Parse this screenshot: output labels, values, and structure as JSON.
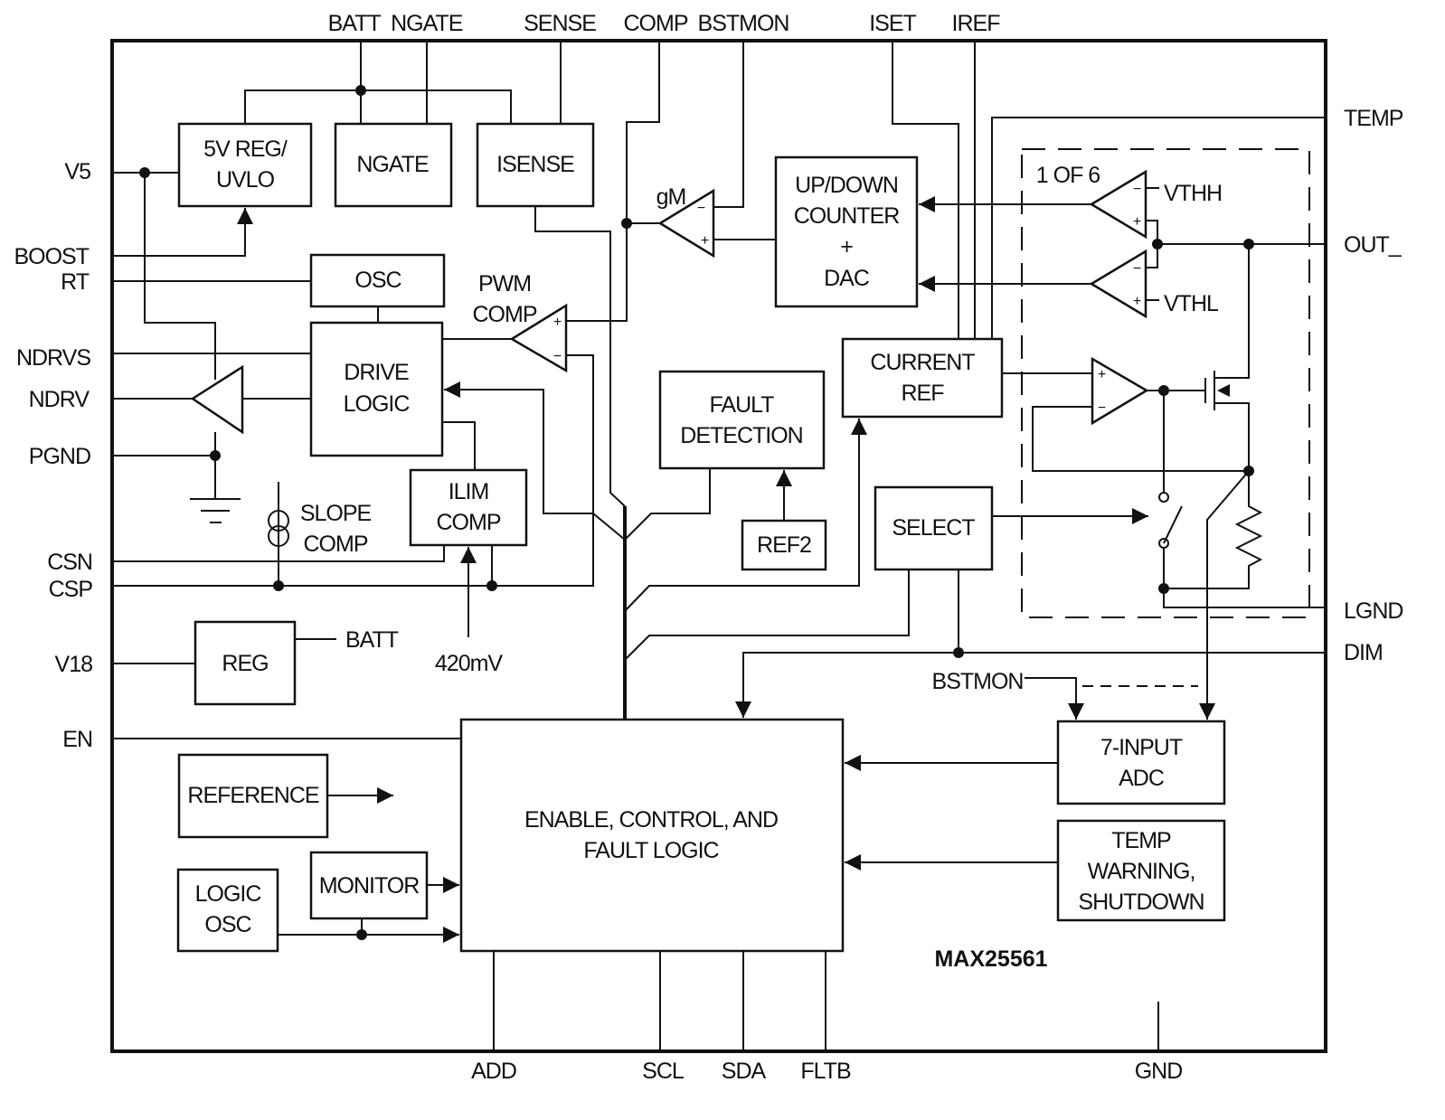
{
  "chip_name": "MAX25561",
  "pins": {
    "left": {
      "v5": "V5",
      "boost": "BOOST",
      "rt": "RT",
      "ndrvs": "NDRVS",
      "ndrv": "NDRV",
      "pgnd": "PGND",
      "csn": "CSN",
      "csp": "CSP",
      "v18": "V18",
      "en": "EN"
    },
    "top": {
      "batt_ngate": "BATT  NGATE",
      "sense": "SENSE",
      "comp": "COMP",
      "bstmon": "BSTMON",
      "iset": "ISET",
      "iref": "IREF"
    },
    "right": {
      "temp": "TEMP",
      "out": "OUT_",
      "lgnd": "LGND",
      "dim": "DIM"
    },
    "bottom": {
      "add": "ADD",
      "scl": "SCL",
      "sda": "SDA",
      "fltb": "FLTB",
      "gnd": "GND"
    }
  },
  "blocks": {
    "reg5v": [
      "5V REG/",
      "UVLO"
    ],
    "ngate": "NGATE",
    "isense": "ISENSE",
    "osc": "OSC",
    "drive_logic": [
      "DRIVE",
      "LOGIC"
    ],
    "ilim_comp": [
      "ILIM",
      "COMP"
    ],
    "reg": "REG",
    "reference": "REFERENCE",
    "logic_osc": [
      "LOGIC",
      "OSC"
    ],
    "monitor": "MONITOR",
    "enable_control": [
      "ENABLE, CONTROL, AND",
      "FAULT LOGIC"
    ],
    "updown_counter": [
      "UP/DOWN",
      "COUNTER",
      "+",
      "DAC"
    ],
    "fault_detection": [
      "FAULT",
      "DETECTION"
    ],
    "ref2": "REF2",
    "current_ref": [
      "CURRENT",
      "REF"
    ],
    "select": "SELECT",
    "adc": [
      "7-INPUT",
      "ADC"
    ],
    "temp_warning": [
      "TEMP",
      "WARNING,",
      "SHUTDOWN"
    ]
  },
  "labels": {
    "pwm_comp": [
      "PWM",
      "COMP"
    ],
    "gm": "gM",
    "vthh": "VTHH",
    "vthl": "VTHL",
    "one_of_six": "1 OF 6",
    "slope_comp": [
      "SLOPE",
      "COMP"
    ],
    "batt": "BATT",
    "v420": "420mV",
    "bstmon_internal": "BSTMON",
    "plus": "+",
    "minus": "−"
  }
}
